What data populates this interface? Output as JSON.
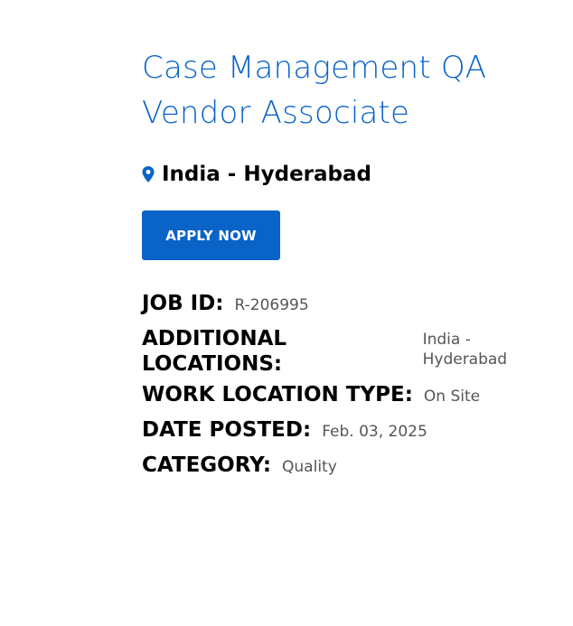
{
  "job": {
    "title": "Case Management QA Vendor Associate",
    "location": "India - Hyderabad",
    "apply_label": "APPLY NOW"
  },
  "details": {
    "job_id_label": "JOB ID:",
    "job_id_value": "R-206995",
    "additional_locations_label": "ADDITIONAL LOCATIONS:",
    "additional_locations_value": "India - Hyderabad",
    "work_location_type_label": "WORK LOCATION TYPE:",
    "work_location_type_value": "On Site",
    "date_posted_label": "DATE POSTED:",
    "date_posted_value": "Feb. 03, 2025",
    "category_label": "CATEGORY:",
    "category_value": "Quality"
  },
  "icons": {
    "location": "map-pin-icon"
  },
  "colors": {
    "accent": "#0a63c7",
    "value_text": "#555555",
    "label_text": "#000000"
  }
}
